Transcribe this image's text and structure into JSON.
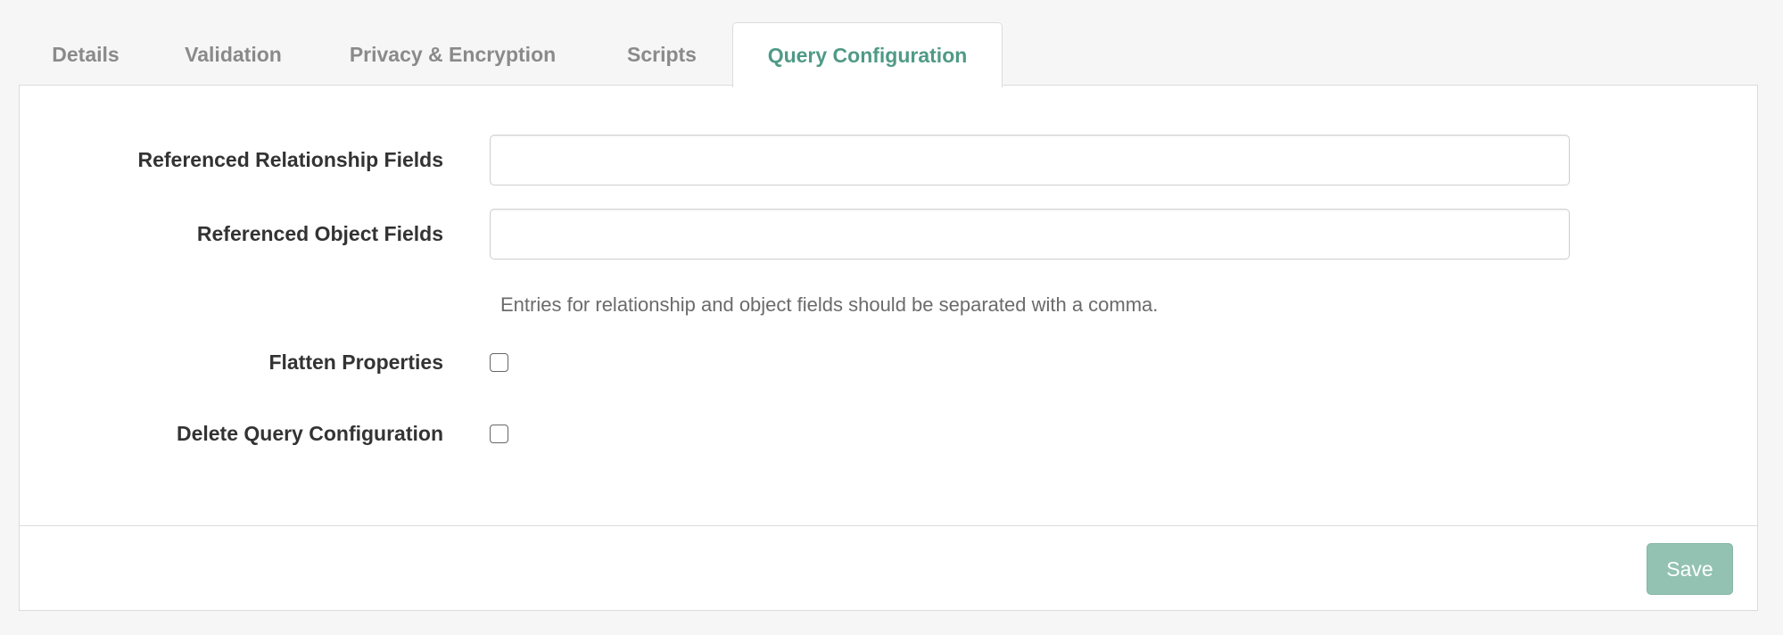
{
  "tabs": [
    {
      "label": "Details",
      "active": false
    },
    {
      "label": "Validation",
      "active": false
    },
    {
      "label": "Privacy & Encryption",
      "active": false
    },
    {
      "label": "Scripts",
      "active": false
    },
    {
      "label": "Query Configuration",
      "active": true
    }
  ],
  "form": {
    "referenced_relationship_fields": {
      "label": "Referenced Relationship Fields",
      "value": "",
      "placeholder": ""
    },
    "referenced_object_fields": {
      "label": "Referenced Object Fields",
      "value": "",
      "placeholder": ""
    },
    "help_text": "Entries for relationship and object fields should be separated with a comma.",
    "flatten_properties": {
      "label": "Flatten Properties",
      "checked": false
    },
    "delete_query_configuration": {
      "label": "Delete Query Configuration",
      "checked": false
    }
  },
  "footer": {
    "save_label": "Save"
  },
  "colors": {
    "accent": "#4f9a86",
    "save_button": "#93c2b3",
    "inactive_tab_text": "#8a8a8a"
  }
}
